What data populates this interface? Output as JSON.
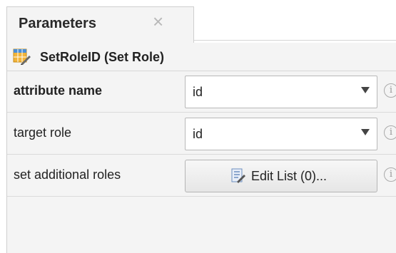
{
  "tab": {
    "title": "Parameters",
    "close_glyph": "×"
  },
  "operator": {
    "title": "SetRoleID (Set Role)",
    "icon": "set-role-icon"
  },
  "parameters": [
    {
      "label": "attribute name",
      "value": "id",
      "type": "combo",
      "bold": true
    },
    {
      "label": "target role",
      "value": "id",
      "type": "combo",
      "bold": false
    },
    {
      "label": "set additional roles",
      "button_label": "Edit List (0)...",
      "type": "button",
      "bold": false
    }
  ],
  "info_glyph": "i",
  "colors": {
    "panel_bg": "#f4f4f4",
    "border": "#cfcfcf",
    "close_gray": "#b8b8b8"
  }
}
